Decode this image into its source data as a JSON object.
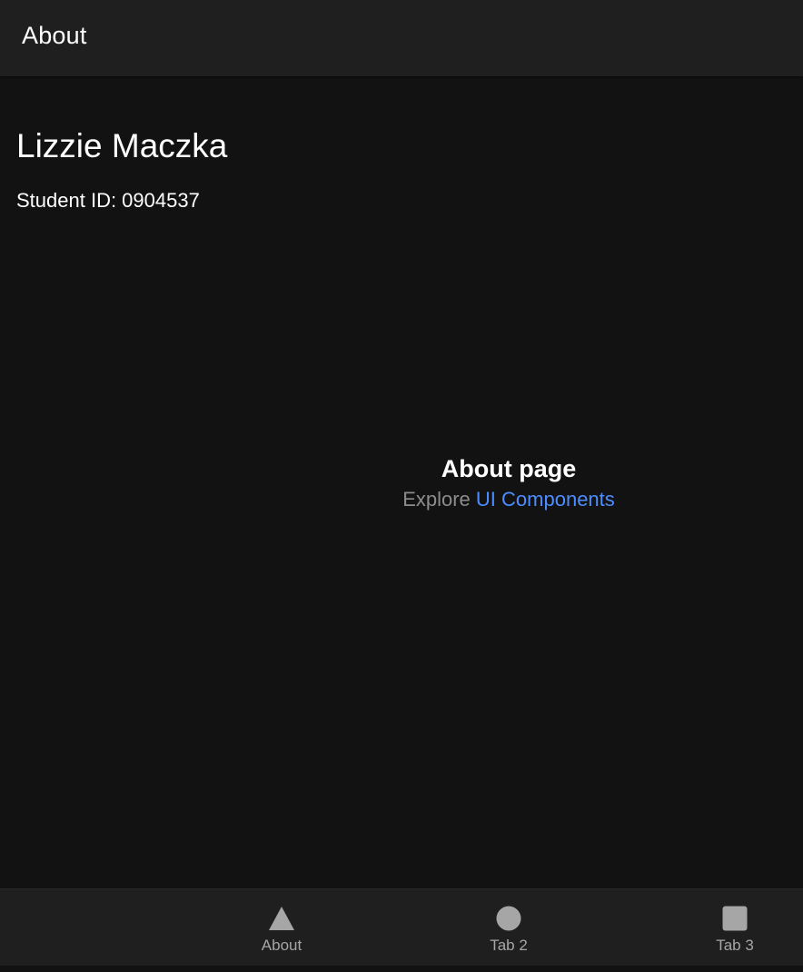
{
  "header": {
    "title": "About"
  },
  "profile": {
    "name": "Lizzie Maczka",
    "student_id": "Student ID: 0904537"
  },
  "explore": {
    "title": "About page",
    "prefix": "Explore",
    "link_text": "UI Components"
  },
  "tabs": [
    {
      "label": "About",
      "icon": "triangle-icon"
    },
    {
      "label": "Tab 2",
      "icon": "ellipse-icon"
    },
    {
      "label": "Tab 3",
      "icon": "square-icon"
    }
  ],
  "colors": {
    "background": "#121212",
    "toolbar": "#1f1f1f",
    "link": "#4d8dff",
    "tab_icon": "#a6a6a6",
    "muted_text": "#8c8c8c"
  }
}
